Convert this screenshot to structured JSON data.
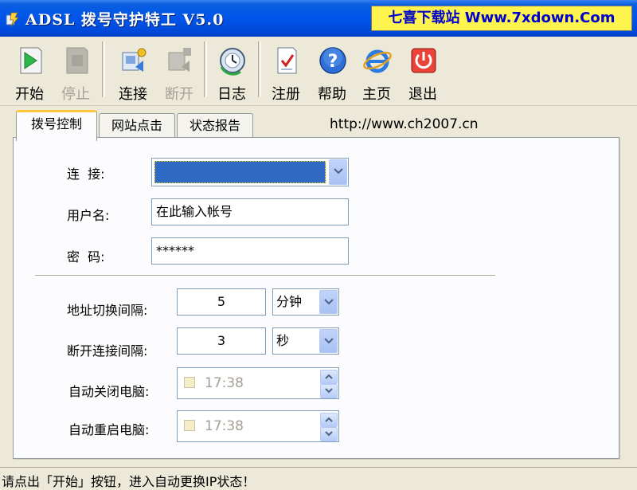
{
  "window": {
    "title": "ADSL 拨号守护特工 V5.0",
    "watermark": "七喜下载站 Www.7xdown.Com"
  },
  "toolbar": {
    "start": "开始",
    "stop": "停止",
    "connect": "连接",
    "disconnect": "断开",
    "log": "日志",
    "register": "注册",
    "help": "帮助",
    "homepage": "主页",
    "exit": "退出"
  },
  "tabs": [
    {
      "label": "拨号控制",
      "active": true
    },
    {
      "label": "网站点击",
      "active": false
    },
    {
      "label": "状态报告",
      "active": false
    }
  ],
  "url": "http://www.ch2007.cn",
  "form": {
    "connection_label": "连  接:",
    "connection_value": "",
    "username_label": "用户名:",
    "username_value": "在此输入帐号",
    "password_label": "密  码:",
    "password_value": "******",
    "addr_interval_label": "地址切换间隔:",
    "addr_interval_value": "5",
    "addr_interval_unit": "分钟",
    "disconnect_interval_label": "断开连接间隔:",
    "disconnect_interval_value": "3",
    "disconnect_interval_unit": "秒",
    "auto_shutdown_label": "自动关闭电脑:",
    "auto_shutdown_time": "17:38",
    "auto_restart_label": "自动重启电脑:",
    "auto_restart_time": "17:38"
  },
  "status": {
    "text": "请点出「开始」按钮，进入自动更换IP状态！"
  },
  "colors": {
    "titlebar": "#0055ea",
    "selection": "#316ac5",
    "active_tab_accent": "#ffc83c",
    "watermark_bg": "#fff34d",
    "watermark_text": "#0000cc"
  }
}
